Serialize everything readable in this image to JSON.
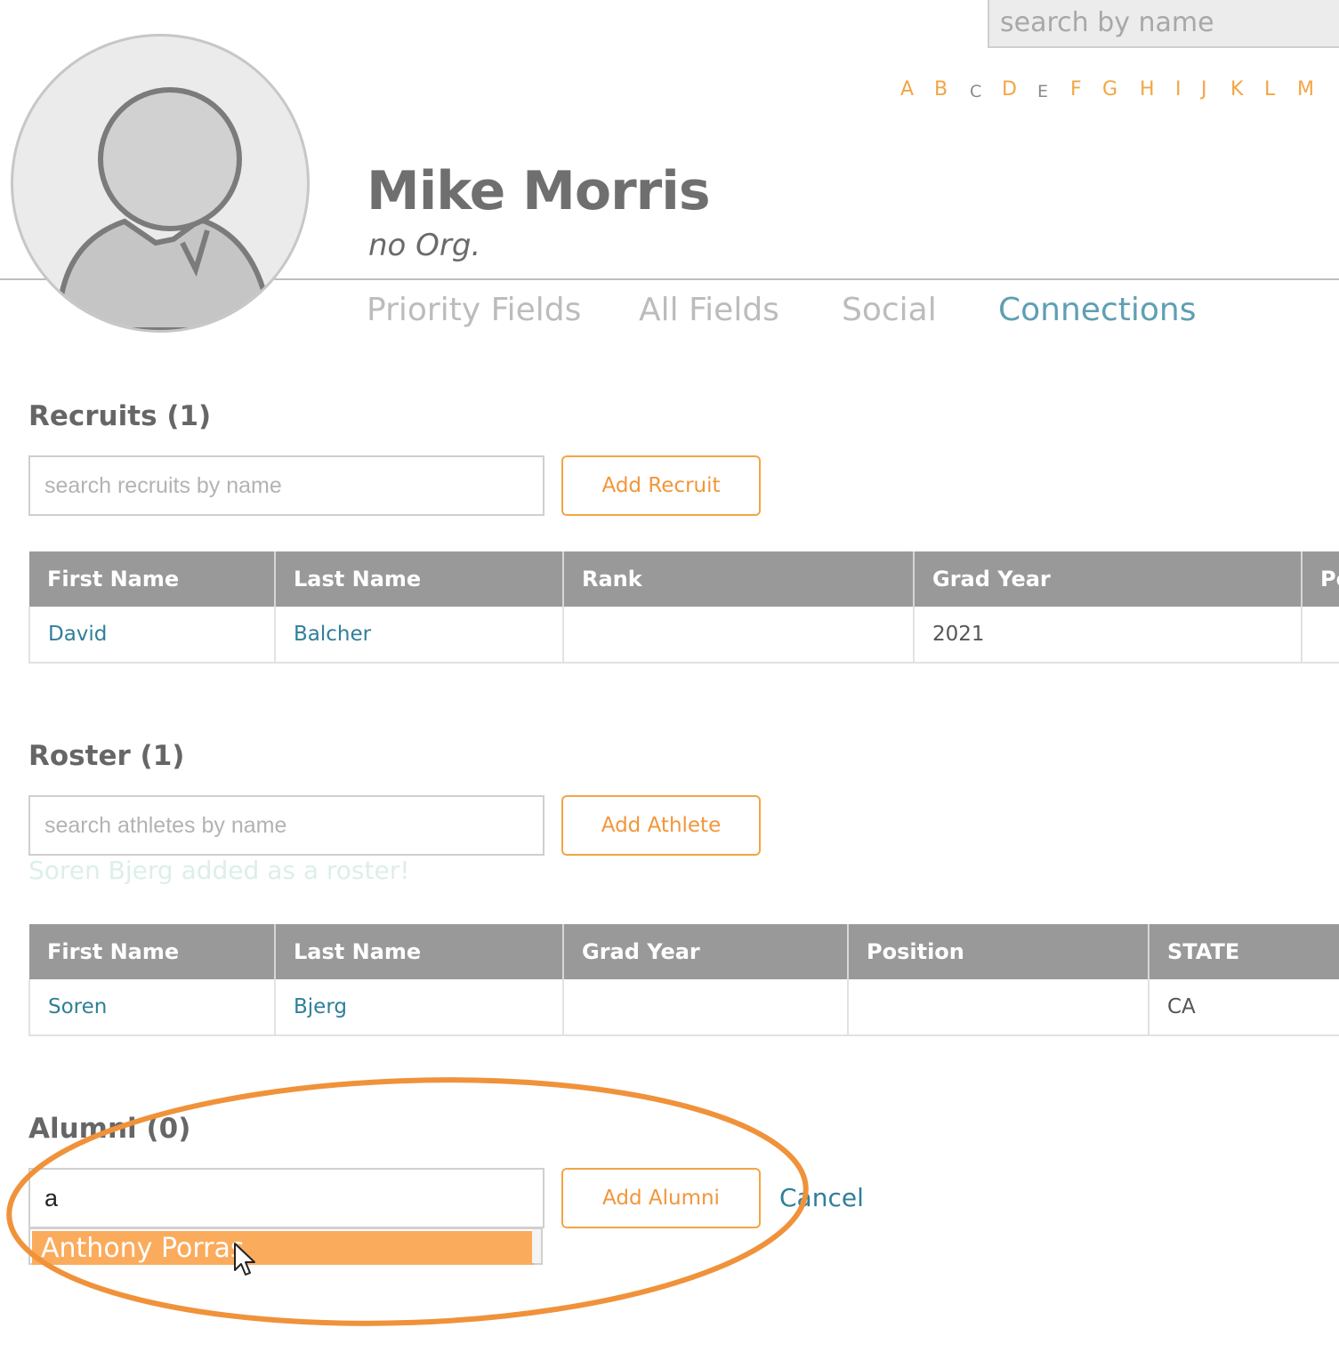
{
  "top_search": {
    "placeholder": "search by name"
  },
  "alphabet": [
    "A",
    "B",
    "C",
    "D",
    "E",
    "F",
    "G",
    "H",
    "I",
    "J",
    "K",
    "L",
    "M"
  ],
  "profile": {
    "name": "Mike Morris",
    "org": "no Org."
  },
  "tabs": [
    {
      "label": "Priority Fields",
      "active": false
    },
    {
      "label": "All Fields",
      "active": false
    },
    {
      "label": "Social",
      "active": false
    },
    {
      "label": "Connections",
      "active": true
    }
  ],
  "recruits": {
    "title": "Recruits (1)",
    "search_placeholder": "search recruits by name",
    "add_label": "Add Recruit",
    "columns": [
      "First Name",
      "Last Name",
      "Rank",
      "Grad Year",
      "Po"
    ],
    "rows": [
      [
        "David",
        "Balcher",
        "",
        "2021",
        ""
      ]
    ]
  },
  "roster": {
    "title": "Roster (1)",
    "search_placeholder": "search athletes by name",
    "add_label": "Add Athlete",
    "message": "Soren Bjerg added as a roster!",
    "columns": [
      "First Name",
      "Last Name",
      "Grad Year",
      "Position",
      "STATE"
    ],
    "rows": [
      [
        "Soren",
        "Bjerg",
        "",
        "",
        "CA"
      ]
    ]
  },
  "alumni": {
    "title": "Alumni (0)",
    "search_value": "a",
    "add_label": "Add Alumni",
    "cancel_label": "Cancel",
    "suggestion": "Anthony Porras"
  },
  "colors": {
    "accent_orange": "#f2a544",
    "link_teal": "#2f7f9a",
    "active_tab": "#5f9fb3",
    "table_header": "#999999",
    "highlight_ring": "#f0923a"
  }
}
